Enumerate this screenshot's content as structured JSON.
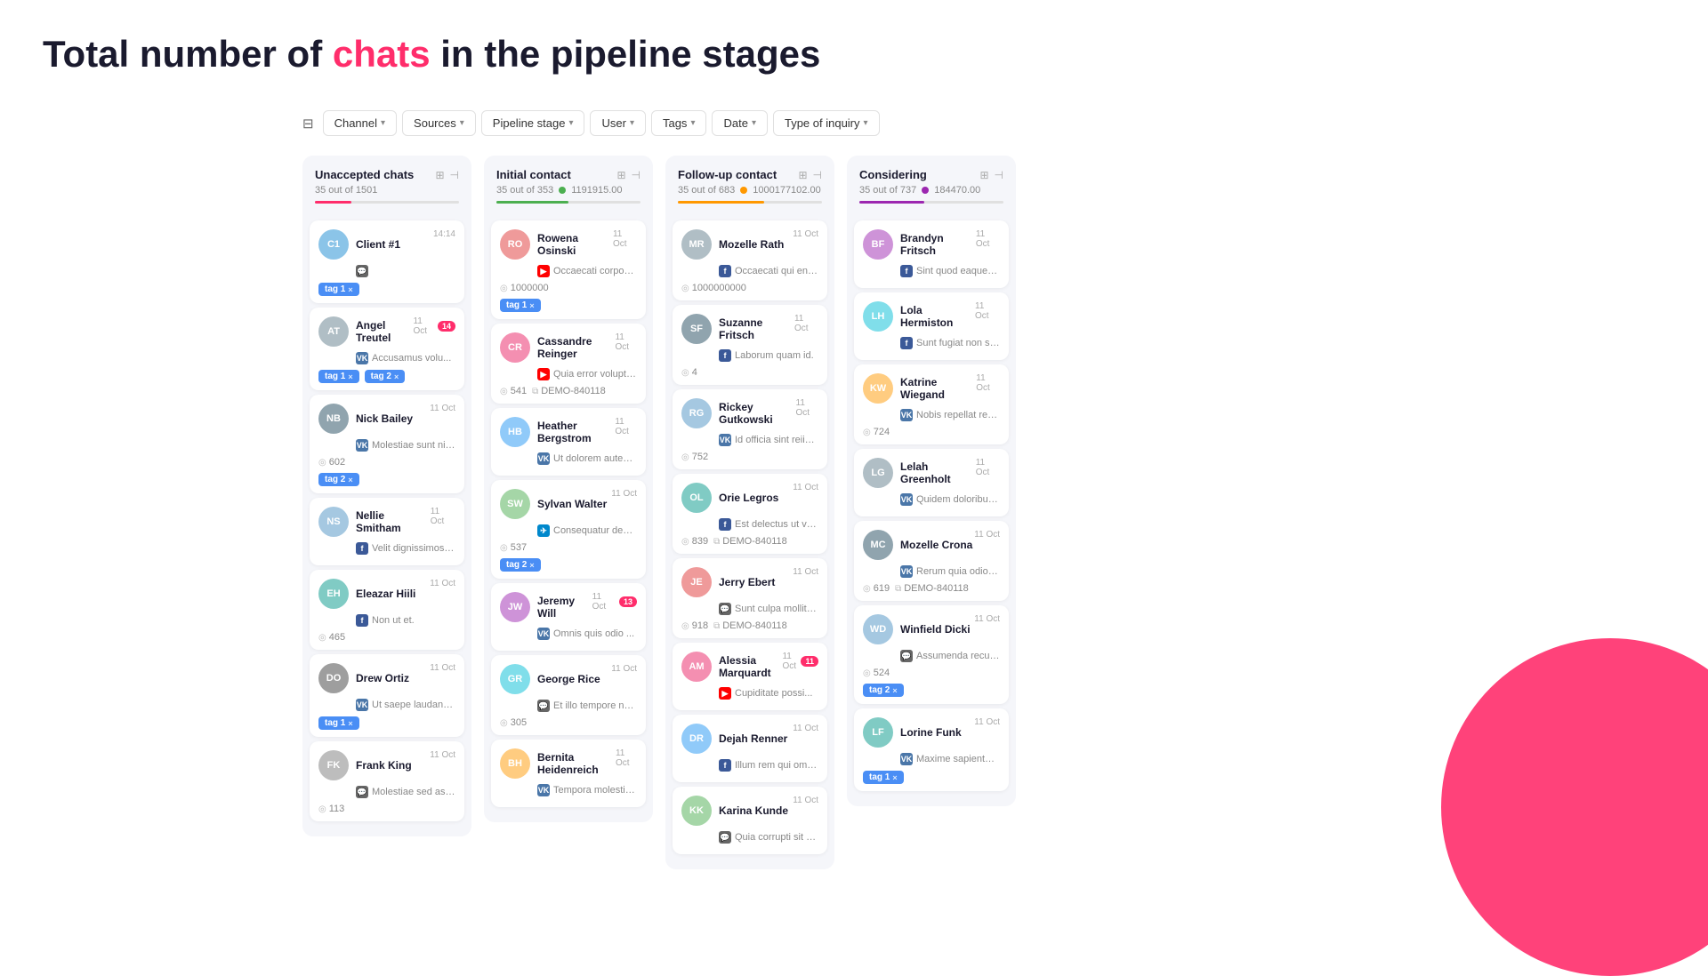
{
  "title": {
    "part1": "Total number of ",
    "highlight": "chats",
    "part2": " in the pipeline stages"
  },
  "filters": {
    "icon": "⊟",
    "items": [
      "Channel",
      "Sources",
      "Pipeline stage",
      "User",
      "Tags",
      "Date",
      "Type of inquiry"
    ]
  },
  "columns": [
    {
      "id": "unaccepted",
      "title": "Unaccepted chats",
      "count": "35 out of 1501",
      "dotColor": "#ccc",
      "progressColor": "#ff2d6b",
      "progressPct": 25,
      "totalValue": null,
      "cards": [
        {
          "initials": "C1",
          "avatarColor": "#8bc4e8",
          "name": "Client #1",
          "date": "14:14",
          "source": "chat",
          "preview": "",
          "num": null,
          "tags": [
            "tag 1"
          ],
          "badge": null,
          "extraTag": null
        },
        {
          "initials": "AT",
          "avatarColor": "#b0bec5",
          "name": "Angel Treutel",
          "date": "11 Oct",
          "source": "vk",
          "preview": "Accusamus volu...",
          "num": null,
          "tags": [
            "tag 1",
            "tag 2"
          ],
          "badge": "14",
          "extraTag": null
        },
        {
          "initials": "NB",
          "avatarColor": "#90a4ae",
          "name": "Nick Bailey",
          "date": "11 Oct",
          "source": "vk",
          "preview": "Molestiae sunt nihil illo...",
          "num": "602",
          "tags": [
            "tag 2"
          ],
          "badge": null,
          "extraTag": null
        },
        {
          "initials": "NS",
          "avatarColor": "#a5c8e1",
          "name": "Nellie Smitham",
          "date": "11 Oct",
          "source": "fb",
          "preview": "Velit dignissimos recus...",
          "num": null,
          "tags": [],
          "badge": null,
          "extraTag": null
        },
        {
          "initials": "EH",
          "avatarColor": "#80cbc4",
          "name": "Eleazar Hiili",
          "date": "11 Oct",
          "source": "fb",
          "preview": "Non ut et.",
          "num": "465",
          "tags": [],
          "badge": null,
          "extraTag": null
        },
        {
          "initials": "DO",
          "avatarColor": "#9e9e9e",
          "name": "Drew Ortiz",
          "date": "11 Oct",
          "source": "vk",
          "preview": "Ut saepe laudantium e...",
          "num": null,
          "tags": [
            "tag 1"
          ],
          "badge": null,
          "extraTag": null
        },
        {
          "initials": "FK",
          "avatarColor": "#bdbdbd",
          "name": "Frank King",
          "date": "11 Oct",
          "source": "chat",
          "preview": "Molestiae sed asperior...",
          "num": "113",
          "tags": [],
          "badge": null,
          "extraTag": null
        }
      ]
    },
    {
      "id": "initial",
      "title": "Initial contact",
      "count": "35 out of 353",
      "dotColor": "#4caf50",
      "progressColor": "#4caf50",
      "progressPct": 50,
      "totalValue": "1191915.00",
      "cards": [
        {
          "initials": "RO",
          "avatarColor": "#ef9a9a",
          "name": "Rowena Osinski",
          "date": "11 Oct",
          "source": "yt",
          "preview": "Occaecati corporis sit.",
          "num": "1000000",
          "tags": [
            "tag 1"
          ],
          "badge": null,
          "extraTag": null
        },
        {
          "initials": "CR",
          "avatarColor": "#f48fb1",
          "name": "Cassandre Reinger",
          "date": "11 Oct",
          "source": "yt",
          "preview": "Quia error voluptates ...",
          "num": "541",
          "numLabel": "DEMO-840118",
          "tags": [],
          "badge": null,
          "extraTag": null
        },
        {
          "initials": "HB",
          "avatarColor": "#90caf9",
          "name": "Heather Bergstrom",
          "date": "11 Oct",
          "source": "vk",
          "preview": "Ut dolorem autem am...",
          "num": null,
          "tags": [],
          "badge": null,
          "extraTag": null
        },
        {
          "initials": "SW",
          "avatarColor": "#a5d6a7",
          "name": "Sylvan Walter",
          "date": "11 Oct",
          "source": "tg",
          "preview": "Consequatur deserunt...",
          "num": "537",
          "tags": [
            "tag 2"
          ],
          "badge": null,
          "extraTag": null
        },
        {
          "initials": "JW",
          "avatarColor": "#ce93d8",
          "name": "Jeremy Will",
          "date": "11 Oct",
          "source": "vk",
          "preview": "Omnis quis odio ...",
          "num": null,
          "tags": [],
          "badge": "13",
          "extraTag": null
        },
        {
          "initials": "GR",
          "avatarColor": "#80deea",
          "name": "George Rice",
          "date": "11 Oct",
          "source": "chat",
          "preview": "Et illo tempore nesciu...",
          "num": "305",
          "tags": [],
          "badge": null,
          "extraTag": null
        },
        {
          "initials": "BH",
          "avatarColor": "#ffcc80",
          "name": "Bernita Heidenreich",
          "date": "11 Oct",
          "source": "vk",
          "preview": "Tempora molestiae na...",
          "num": null,
          "tags": [],
          "badge": null,
          "extraTag": null
        }
      ]
    },
    {
      "id": "followup",
      "title": "Follow-up contact",
      "count": "35 out of 683",
      "dotColor": "#ff9800",
      "progressColor": "#ff9800",
      "progressPct": 60,
      "totalValue": "1000177102.00",
      "cards": [
        {
          "initials": "MR",
          "avatarColor": "#b0bec5",
          "name": "Mozelle Rath",
          "date": "11 Oct",
          "source": "fb",
          "preview": "Occaecati qui enim rer...",
          "num": "1000000000",
          "tags": [],
          "badge": null,
          "extraTag": null
        },
        {
          "initials": "SF",
          "avatarColor": "#90a4ae",
          "name": "Suzanne Fritsch",
          "date": "11 Oct",
          "source": "fb",
          "preview": "Laborum quam id.",
          "num": "4",
          "tags": [],
          "badge": null,
          "extraTag": null
        },
        {
          "initials": "RG",
          "avatarColor": "#a5c8e1",
          "name": "Rickey Gutkowski",
          "date": "11 Oct",
          "source": "vk",
          "preview": "Id officia sint reiiciend...",
          "num": "752",
          "tags": [],
          "badge": null,
          "extraTag": null
        },
        {
          "initials": "OL",
          "avatarColor": "#80cbc4",
          "name": "Orie Legros",
          "date": "11 Oct",
          "source": "fb",
          "preview": "Est delectus ut volupt...",
          "num": "839",
          "numLabel": "DEMO-840118",
          "tags": [],
          "badge": null,
          "extraTag": null
        },
        {
          "initials": "JE",
          "avatarColor": "#ef9a9a",
          "name": "Jerry Ebert",
          "date": "11 Oct",
          "source": "chat",
          "preview": "Sunt culpa mollitia no...",
          "num": "918",
          "numLabel": "DEMO-840118",
          "tags": [],
          "badge": null,
          "extraTag": null
        },
        {
          "initials": "AM",
          "avatarColor": "#f48fb1",
          "name": "Alessia Marquardt",
          "date": "11 Oct",
          "source": "yt",
          "preview": "Cupiditate possi...",
          "num": null,
          "tags": [],
          "badge": "11",
          "extraTag": null
        },
        {
          "initials": "DR",
          "avatarColor": "#90caf9",
          "name": "Dejah Renner",
          "date": "11 Oct",
          "source": "fb",
          "preview": "Illum rem qui omnis.",
          "num": null,
          "tags": [],
          "badge": null,
          "extraTag": null
        },
        {
          "initials": "KK",
          "avatarColor": "#a5d6a7",
          "name": "Karina Kunde",
          "date": "11 Oct",
          "source": "chat",
          "preview": "Quia corrupti sit est la...",
          "num": null,
          "tags": [],
          "badge": null,
          "extraTag": null
        }
      ]
    },
    {
      "id": "considering",
      "title": "Considering",
      "count": "35 out of 737",
      "dotColor": "#9c27b0",
      "progressColor": "#9c27b0",
      "progressPct": 45,
      "totalValue": "184470.00",
      "cards": [
        {
          "initials": "BF",
          "avatarColor": "#ce93d8",
          "name": "Brandyn Fritsch",
          "date": "11 Oct",
          "source": "fb",
          "preview": "Sint quod eaque praes...",
          "num": null,
          "tags": [],
          "badge": null,
          "extraTag": null
        },
        {
          "initials": "LH",
          "avatarColor": "#80deea",
          "name": "Lola Hermiston",
          "date": "11 Oct",
          "source": "fb",
          "preview": "Sunt fugiat non sint.",
          "num": null,
          "tags": [],
          "badge": null,
          "extraTag": null
        },
        {
          "initials": "KW",
          "avatarColor": "#ffcc80",
          "name": "Katrine Wiegand",
          "date": "11 Oct",
          "source": "vk",
          "preview": "Nobis repellat rem eni...",
          "num": "724",
          "tags": [],
          "badge": null,
          "extraTag": null
        },
        {
          "initials": "LG",
          "avatarColor": "#b0bec5",
          "name": "Lelah Greenholt",
          "date": "11 Oct",
          "source": "vk",
          "preview": "Quidem doloribus mol...",
          "num": null,
          "tags": [],
          "badge": null,
          "extraTag": null
        },
        {
          "initials": "MC",
          "avatarColor": "#90a4ae",
          "name": "Mozelle Crona",
          "date": "11 Oct",
          "source": "vk",
          "preview": "Rerum quia odio archi...",
          "num": "619",
          "numLabel": "DEMO-840118",
          "tags": [],
          "badge": null,
          "extraTag": null
        },
        {
          "initials": "WD",
          "avatarColor": "#a5c8e1",
          "name": "Winfield Dicki",
          "date": "11 Oct",
          "source": "chat",
          "preview": "Assumenda recusanda...",
          "num": "524",
          "tags": [
            "tag 2"
          ],
          "badge": null,
          "extraTag": null
        },
        {
          "initials": "LF",
          "avatarColor": "#80cbc4",
          "name": "Lorine Funk",
          "date": "11 Oct",
          "source": "vk",
          "preview": "Maxime sapiente velit...",
          "num": null,
          "tags": [
            "tag 1"
          ],
          "badge": null,
          "extraTag": null
        }
      ]
    }
  ]
}
